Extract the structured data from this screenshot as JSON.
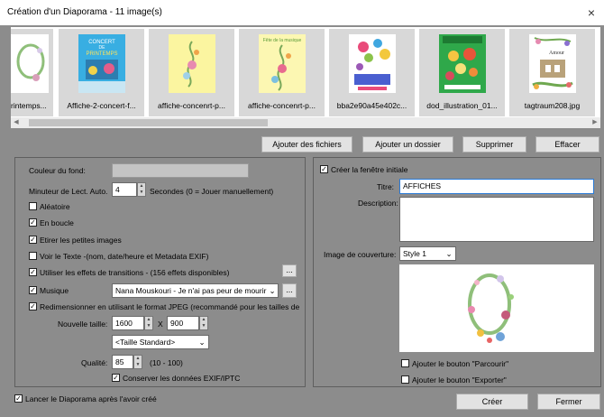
{
  "window": {
    "title": "Création d'un Diaporama - 11 image(s)"
  },
  "thumbnails": [
    {
      "name": "rintemps..."
    },
    {
      "name": "Affiche-2-concert-f..."
    },
    {
      "name": "affiche-concenrt-p..."
    },
    {
      "name": "affiche-concenrt-p..."
    },
    {
      "name": "bba2e90a45e402c..."
    },
    {
      "name": "dod_illustration_01..."
    },
    {
      "name": "tagtraum208.jpg"
    }
  ],
  "thumb_art": {
    "concert_line1": "CONCERT",
    "concert_line2": "DE",
    "concert_line3": "PRINTEMPS",
    "deco_text": "Amour",
    "date_text": "Fête de la musique"
  },
  "file_buttons": {
    "add_files": "Ajouter des fichiers",
    "add_folder": "Ajouter un dossier",
    "delete": "Supprimer",
    "clear": "Effacer"
  },
  "left": {
    "bg_color_label": "Couleur du fond:",
    "timer_label": "Minuteur de Lect. Auto.",
    "timer_value": "4",
    "timer_suffix": "Secondes (0 = Jouer  manuellement)",
    "random": "Aléatoire",
    "loop": "En boucle",
    "stretch": "Etirer les petites images",
    "show_text": "Voir le Texte -(nom, date/heure et Metadata EXIF)",
    "transitions": "Utiliser les effets de transitions  -  (156 effets disponibles)",
    "music": "Musique",
    "music_value": "Nana Mouskouri - Je n'ai pas peur de mourir",
    "resize": "Redimensionner en utilisant le format JPEG (recommandé pour les tailles de f",
    "new_size_label": "Nouvelle taille:",
    "width": "1600",
    "height": "900",
    "x": "X",
    "size_preset": "<Taille Standard>",
    "quality_label": "Qualité:",
    "quality": "85",
    "quality_range": "(10 - 100)",
    "keep_exif": "Conserver les données EXIF/IPTC",
    "ellipsis": "..."
  },
  "right": {
    "create_initial": "Créer la fenêtre initiale",
    "title_label": "Titre:",
    "title_value": "AFFICHES",
    "description_label": "Description:",
    "cover_label": "Image de couverture:",
    "style_value": "Style 1",
    "add_browse": "Ajouter le bouton \"Parcourir\"",
    "add_export": "Ajouter le bouton \"Exporter\""
  },
  "footer": {
    "launch_after": "Lancer le Diaporama après l'avoir créé",
    "create": "Créer",
    "close": "Fermer"
  },
  "icons": {
    "close": "×",
    "check": "✓",
    "dropdown": "⌄",
    "spin_up": "▲",
    "spin_down": "▼",
    "scroll_left": "◀",
    "scroll_right": "▶"
  }
}
